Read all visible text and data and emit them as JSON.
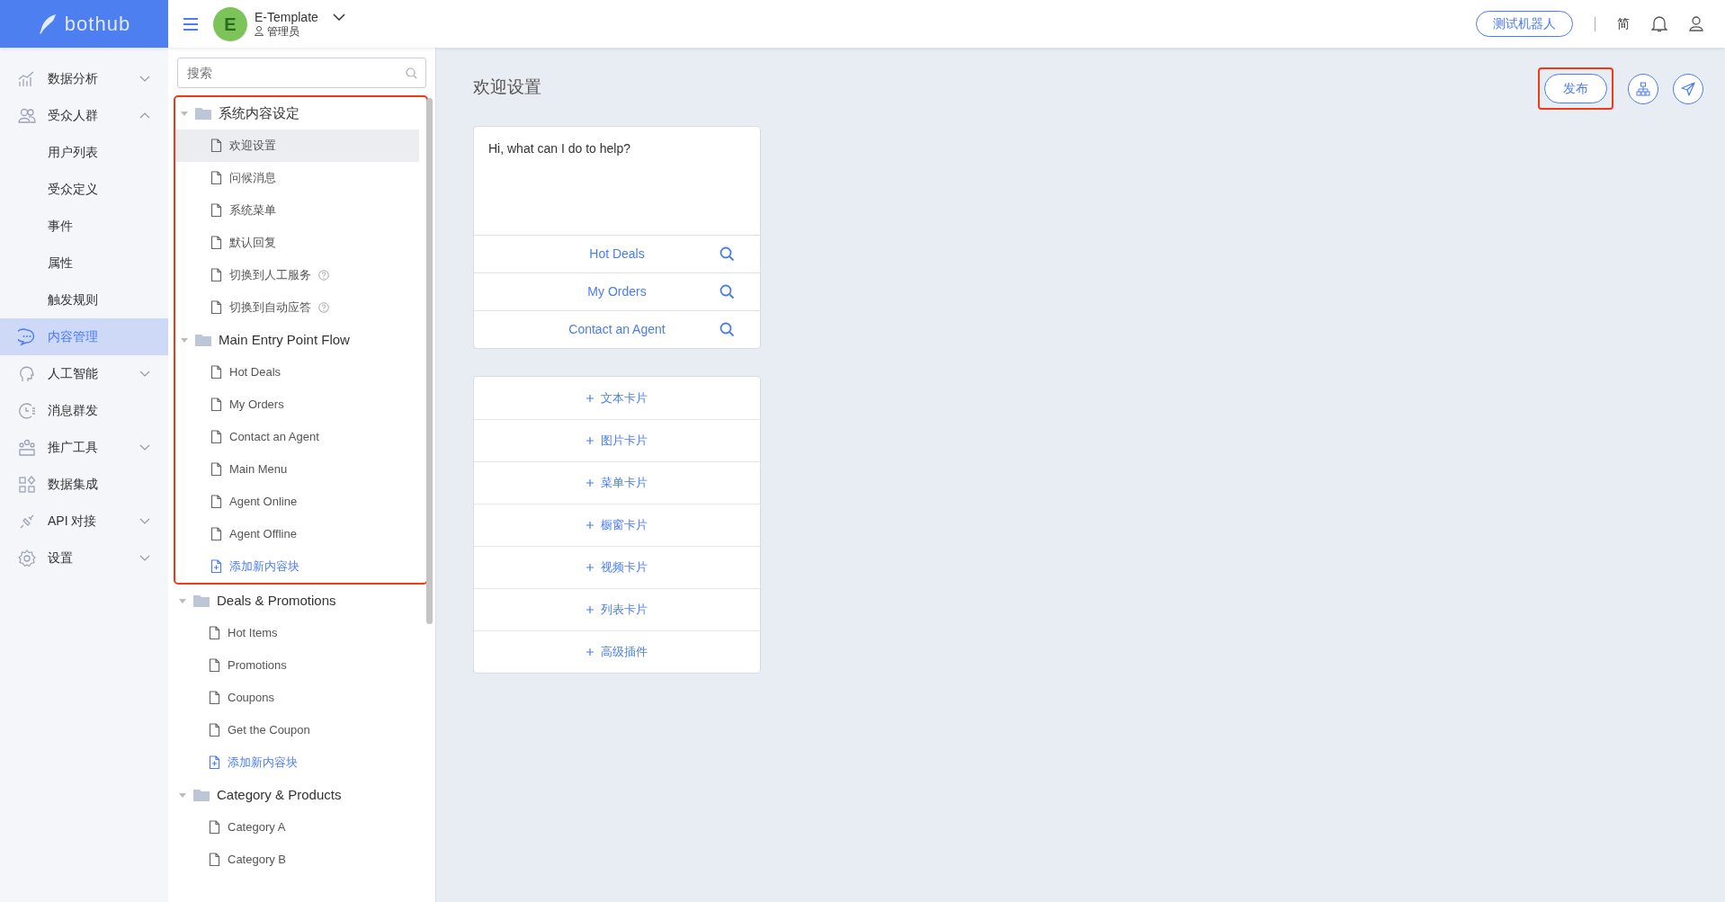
{
  "header": {
    "logo": "bothub",
    "avatar_letter": "E",
    "bot_name": "E-Template",
    "role": "管理员",
    "test_button": "测试机器人",
    "language": "简"
  },
  "sidebar": {
    "items": [
      {
        "label": "数据分析",
        "kind": "group",
        "expanded": false,
        "selected": false
      },
      {
        "label": "受众人群",
        "kind": "group",
        "expanded": true,
        "selected": false,
        "children": [
          {
            "label": "用户列表",
            "selected": false
          },
          {
            "label": "受众定义",
            "selected": false
          },
          {
            "label": "事件",
            "selected": false
          },
          {
            "label": "属性",
            "selected": false
          },
          {
            "label": "触发规则",
            "selected": false
          }
        ]
      },
      {
        "label": "内容管理",
        "kind": "link",
        "selected": true
      },
      {
        "label": "人工智能",
        "kind": "group",
        "expanded": false,
        "selected": false
      },
      {
        "label": "消息群发",
        "kind": "link",
        "selected": false
      },
      {
        "label": "推广工具",
        "kind": "group",
        "expanded": false,
        "selected": false
      },
      {
        "label": "数据集成",
        "kind": "link",
        "selected": false
      },
      {
        "label": "API 对接",
        "kind": "group",
        "expanded": false,
        "selected": false
      },
      {
        "label": "设置",
        "kind": "group",
        "expanded": false,
        "selected": false
      }
    ]
  },
  "tree": {
    "search": {
      "placeholder": "搜索"
    },
    "sections": [
      {
        "highlighted": true,
        "folders": [
          {
            "label": "系统内容设定",
            "expanded": true,
            "children": [
              {
                "label": "欢迎设置",
                "kind": "page",
                "selected": true
              },
              {
                "label": "问候消息",
                "kind": "page",
                "selected": false
              },
              {
                "label": "系统菜单",
                "kind": "page",
                "selected": false
              },
              {
                "label": "默认回复",
                "kind": "page",
                "selected": false
              },
              {
                "label": "切换到人工服务",
                "kind": "page",
                "selected": false,
                "hint": true
              },
              {
                "label": "切换到自动应答",
                "kind": "page",
                "selected": false,
                "hint": true
              }
            ]
          },
          {
            "label": "Main Entry Point Flow",
            "expanded": true,
            "children": [
              {
                "label": "Hot Deals",
                "kind": "page",
                "selected": false
              },
              {
                "label": "My Orders",
                "kind": "page",
                "selected": false
              },
              {
                "label": "Contact an Agent",
                "kind": "page",
                "selected": false
              },
              {
                "label": "Main Menu",
                "kind": "page",
                "selected": false
              },
              {
                "label": "Agent Online",
                "kind": "page",
                "selected": false
              },
              {
                "label": "Agent Offline",
                "kind": "page",
                "selected": false
              },
              {
                "label": "添加新内容块",
                "kind": "add",
                "selected": false
              }
            ]
          }
        ]
      },
      {
        "highlighted": false,
        "folders": [
          {
            "label": "Deals & Promotions",
            "expanded": true,
            "children": [
              {
                "label": "Hot Items",
                "kind": "page",
                "selected": false
              },
              {
                "label": "Promotions",
                "kind": "page",
                "selected": false
              },
              {
                "label": "Coupons",
                "kind": "page",
                "selected": false
              },
              {
                "label": "Get the Coupon",
                "kind": "page",
                "selected": false
              },
              {
                "label": "添加新内容块",
                "kind": "add",
                "selected": false
              }
            ]
          },
          {
            "label": "Category & Products",
            "expanded": true,
            "children": [
              {
                "label": "Category A",
                "kind": "page",
                "selected": false
              },
              {
                "label": "Category B",
                "kind": "page",
                "selected": false
              }
            ]
          }
        ]
      }
    ]
  },
  "main": {
    "title": "欢迎设置",
    "publish_button": {
      "label": "发布",
      "highlighted": true
    },
    "message": {
      "text": "Hi, what can I do to help?",
      "buttons": [
        "Hot Deals",
        "My Orders",
        "Contact an Agent"
      ]
    },
    "add_options": [
      "文本卡片",
      "图片卡片",
      "菜单卡片",
      "橱窗卡片",
      "视频卡片",
      "列表卡片",
      "高级插件"
    ]
  }
}
